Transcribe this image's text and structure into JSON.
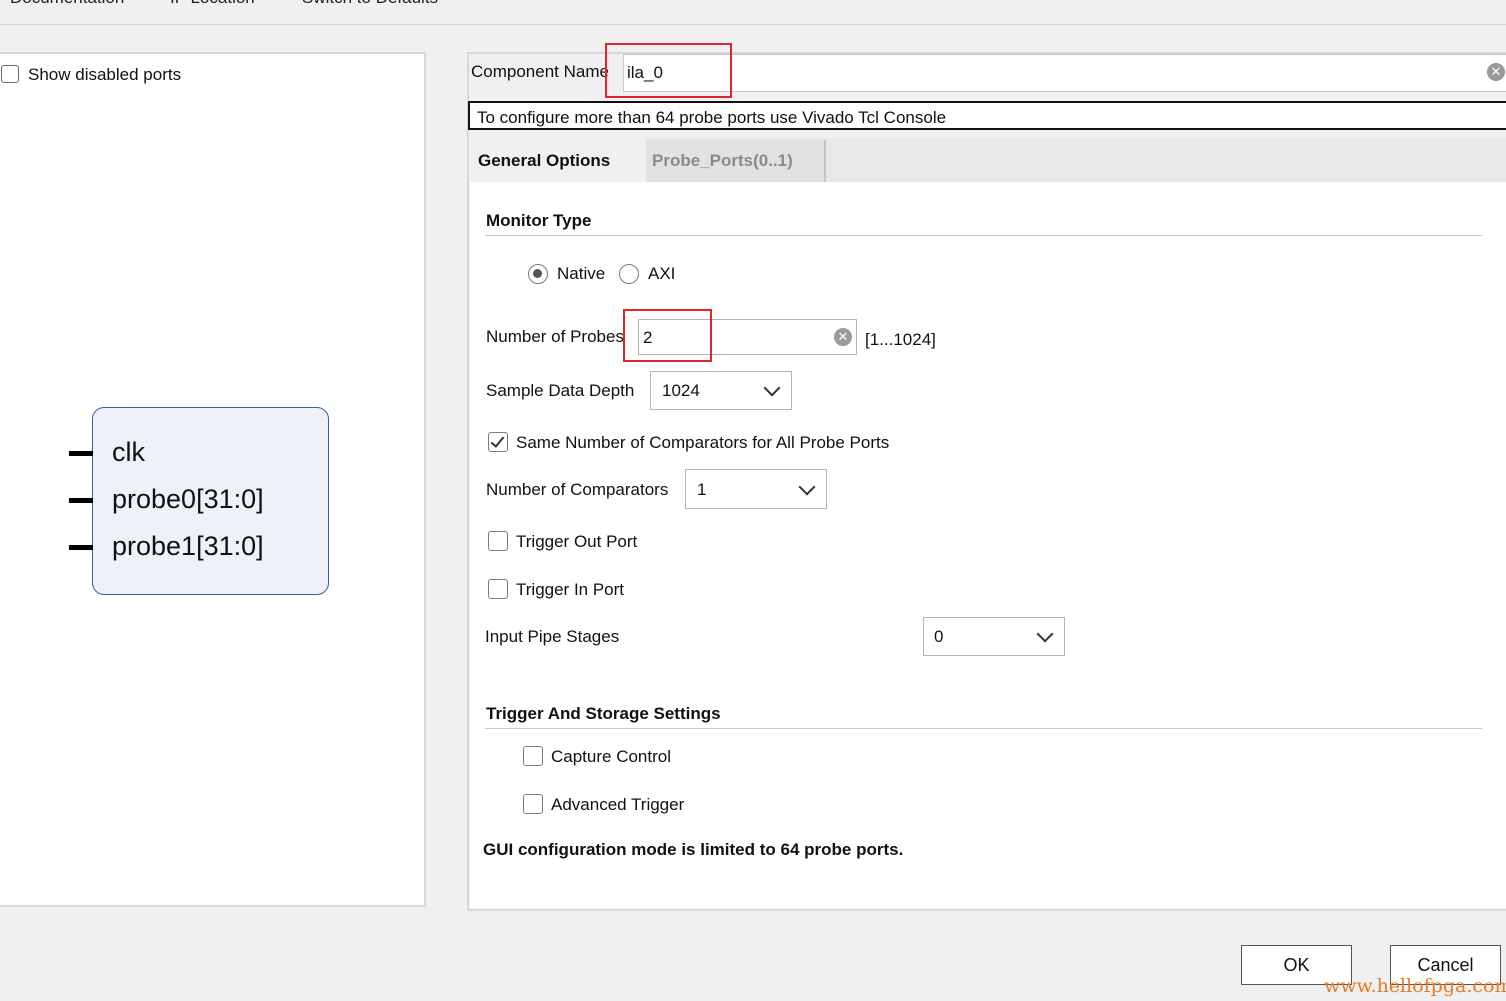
{
  "toolbar": {
    "documentation": "Documentation",
    "ip_location": "IP Location",
    "switch_defaults": "Switch to Defaults"
  },
  "left": {
    "show_disabled_ports": "Show disabled ports",
    "show_disabled_checked": false,
    "ports": [
      "clk",
      "probe0[31:0]",
      "probe1[31:0]"
    ]
  },
  "right": {
    "component_name_label": "Component Name",
    "component_name_value": "ila_0",
    "info": "To configure more than 64 probe ports use Vivado Tcl Console",
    "tabs": [
      "General Options",
      "Probe_Ports(0..1)"
    ],
    "active_tab": "General Options",
    "monitor_type_title": "Monitor Type",
    "radio_native": "Native",
    "radio_axi": "AXI",
    "monitor_selected": "Native",
    "num_probes_label": "Number of Probes",
    "num_probes_value": "2",
    "num_probes_range": "[1...1024]",
    "sample_depth_label": "Sample Data Depth",
    "sample_depth_value": "1024",
    "same_comparators_label": "Same Number of Comparators for All Probe Ports",
    "same_comparators_checked": true,
    "num_comparators_label": "Number of Comparators",
    "num_comparators_value": "1",
    "trigger_out_label": "Trigger Out Port",
    "trigger_in_label": "Trigger In Port",
    "input_pipe_label": "Input Pipe Stages",
    "input_pipe_value": "0",
    "trigger_storage_title": "Trigger And Storage Settings",
    "capture_control_label": "Capture Control",
    "advanced_trigger_label": "Advanced Trigger",
    "gui_note": "GUI configuration mode is limited to 64 probe ports."
  },
  "buttons": {
    "ok": "OK",
    "cancel": "Cancel"
  },
  "watermark": "www.hellofpga.com",
  "colors": {
    "highlight": "#e0262b",
    "symbol_border": "#3a5fa0",
    "watermark": "#e87b25"
  },
  "icons": [
    "clear-icon",
    "chevron-down-icon",
    "check-icon"
  ]
}
